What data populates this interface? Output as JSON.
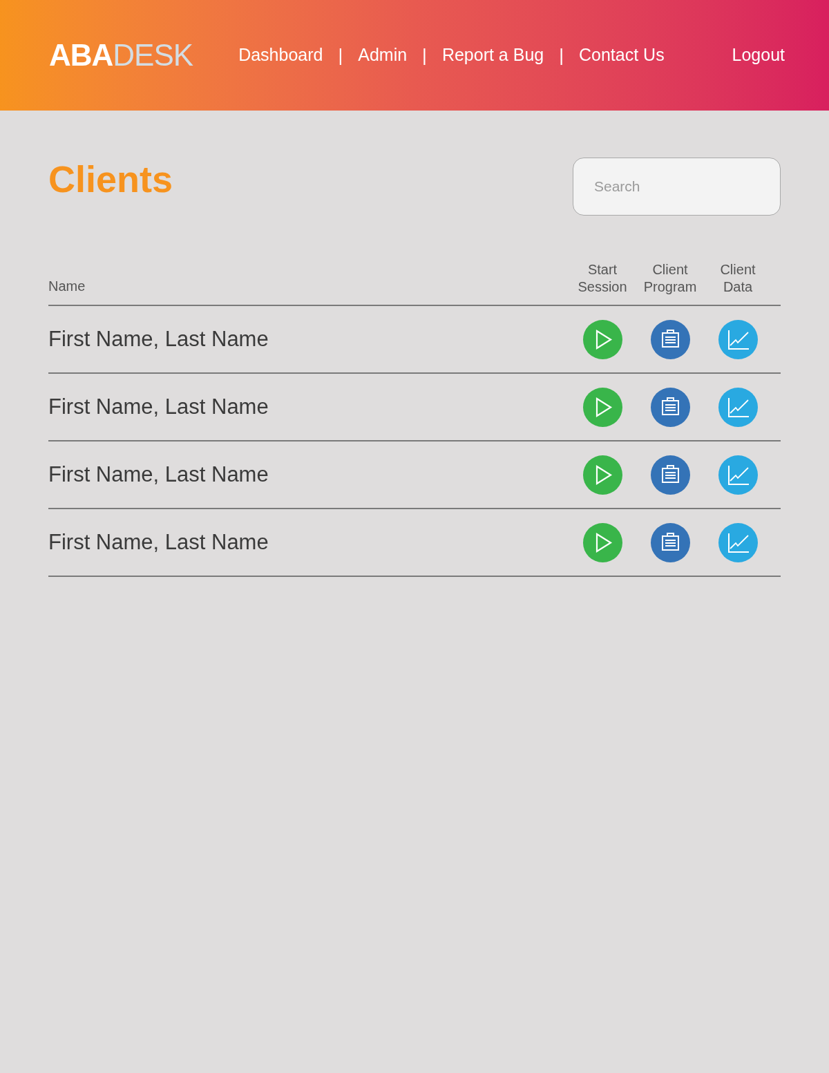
{
  "header": {
    "logo": "**ABA**DESK",
    "nav": [
      {
        "kind": "link",
        "label": "Dashboard"
      },
      {
        "kind": "separator",
        "label": "|"
      },
      {
        "kind": "link",
        "label": "Admin"
      },
      {
        "kind": "separator",
        "label": "|"
      },
      {
        "kind": "link",
        "label": "Report a Bug"
      },
      {
        "kind": "separator",
        "label": "|"
      },
      {
        "kind": "link",
        "label": "Contact Us"
      }
    ],
    "logout": "Logout"
  },
  "page": {
    "title": "Clients",
    "search": {
      "placeholder": "Search"
    }
  },
  "table": {
    "columns": [
      {
        "kind": "name",
        "label": "Name"
      },
      {
        "kind": "session",
        "label": "Start Session"
      },
      {
        "kind": "program",
        "label": "Client Program"
      },
      {
        "kind": "data",
        "label": "Client Data"
      }
    ],
    "rows": [
      {
        "name": "First Name, Last Name"
      },
      {
        "name": "First Name, Last Name"
      },
      {
        "name": "First Name, Last Name"
      },
      {
        "name": "First Name, Last Name"
      }
    ]
  }
}
